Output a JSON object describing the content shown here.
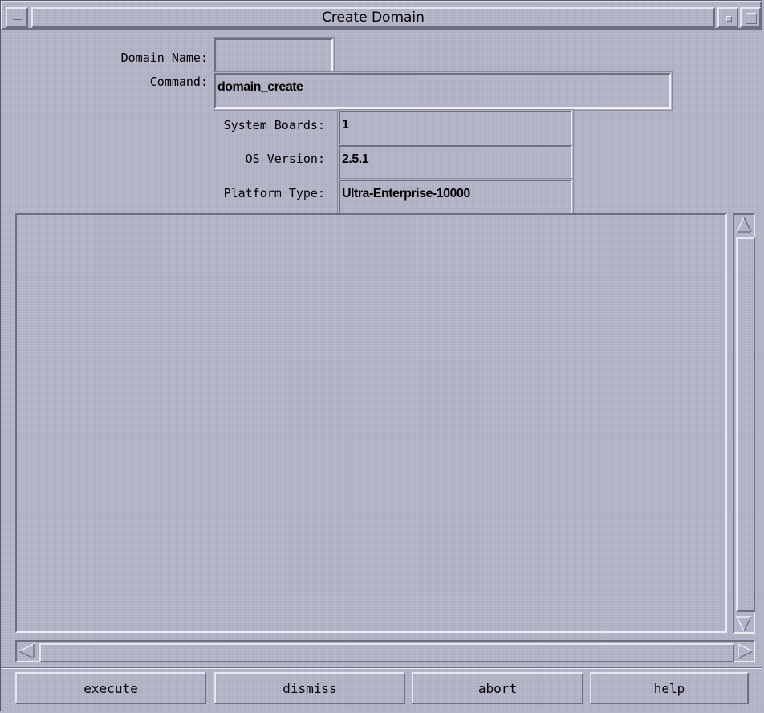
{
  "window": {
    "title": "Create Domain"
  },
  "form": {
    "domain_name": {
      "label": "Domain Name:",
      "value": ""
    },
    "command": {
      "label": "Command:",
      "value": "domain_create"
    },
    "system_boards": {
      "label": "System Boards:",
      "value": "1"
    },
    "os_version": {
      "label": "OS Version:",
      "value": "2.5.1"
    },
    "platform_type": {
      "label": "Platform Type:",
      "value": "Ultra-Enterprise-10000"
    }
  },
  "output": {
    "text": ""
  },
  "buttons": {
    "execute": "execute",
    "dismiss": "dismiss",
    "abort": "abort",
    "help": "help"
  },
  "icons": {
    "window_menu": "window-menu-icon",
    "minimize": "minimize-icon",
    "maximize": "maximize-icon",
    "scroll_up": "arrow-up-icon",
    "scroll_down": "arrow-down-icon",
    "scroll_left": "arrow-left-icon",
    "scroll_right": "arrow-right-icon"
  },
  "colors": {
    "background": "#b4b4c8",
    "shadow": "#6e6e82",
    "highlight": "#ececf4"
  }
}
